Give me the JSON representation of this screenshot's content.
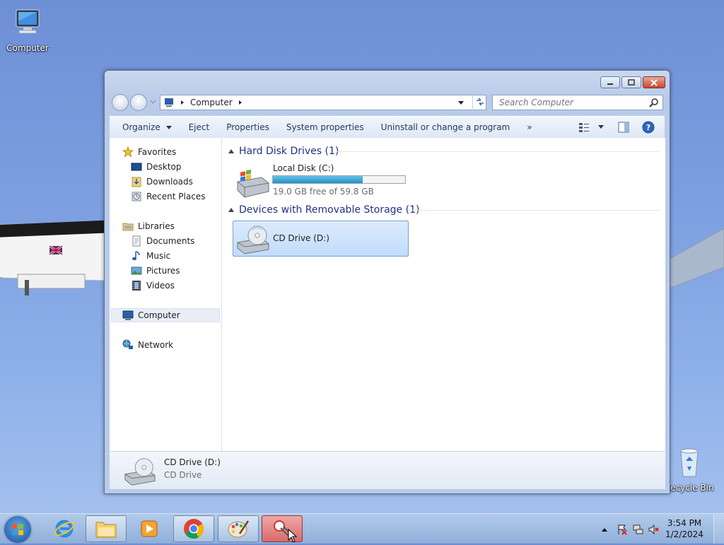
{
  "desktop": {
    "computer_label": "Computer",
    "recycle_label": "Recycle Bin"
  },
  "window": {
    "breadcrumb": "Computer",
    "search_placeholder": "Search Computer",
    "toolbar": {
      "organize": "Organize",
      "eject": "Eject",
      "properties": "Properties",
      "system_properties": "System properties",
      "uninstall": "Uninstall or change a program",
      "more": "»"
    },
    "nav": {
      "favorites": "Favorites",
      "desktop": "Desktop",
      "downloads": "Downloads",
      "recent": "Recent Places",
      "libraries": "Libraries",
      "documents": "Documents",
      "music": "Music",
      "pictures": "Pictures",
      "videos": "Videos",
      "computer": "Computer",
      "network": "Network"
    },
    "groups": {
      "hdd": "Hard Disk Drives (1)",
      "removable": "Devices with Removable Storage (1)"
    },
    "local_disk": {
      "name": "Local Disk (C:)",
      "free": "19.0 GB free of 59.8 GB",
      "used_fraction": 0.68
    },
    "cd_drive": {
      "name": "CD Drive (D:)"
    },
    "details": {
      "name": "CD Drive (D:)",
      "type": "CD Drive"
    }
  },
  "taskbar": {
    "time": "3:54 PM",
    "date": "1/2/2024"
  }
}
